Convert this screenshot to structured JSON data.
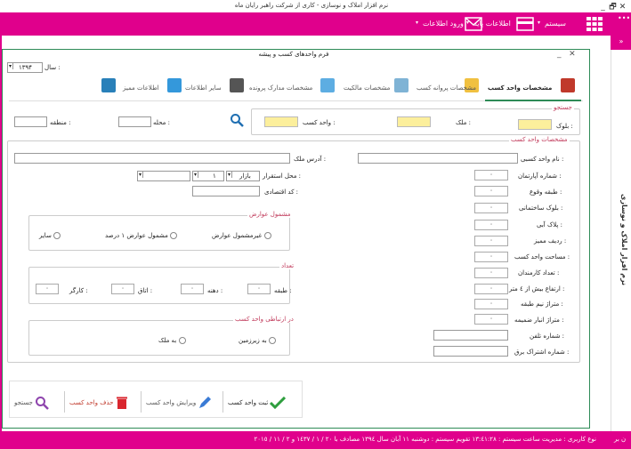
{
  "window": {
    "title": "نرم افزار املاک و نوسازی - کاری از شرکت راهبر رایان ماه",
    "controls": [
      "_",
      "🗗",
      "✕"
    ]
  },
  "menubar": {
    "system": "سیستم",
    "base_info": "اطلاعات پایه",
    "data_entry": "ورود اطلاعات",
    "dots": "•••",
    "collapse": "»"
  },
  "side_panel": {
    "title": "نرم افزار املاک و نوسازی"
  },
  "form": {
    "title": "فرم واحدهای کسب و پیشه",
    "minimize": "_",
    "close": "✕",
    "year_label": "سال :",
    "year_value": "۱۳۹۴",
    "tabs": [
      {
        "label": "مشخصات واحد کسب"
      },
      {
        "label": "مشخصات پروانه کسب"
      },
      {
        "label": "مشخصات مالکیت"
      },
      {
        "label": "مشخصات مدارک پرونده"
      },
      {
        "label": "سایر اطلاعات"
      },
      {
        "label": "اطلاعات ممیز"
      }
    ],
    "search": {
      "legend": "جستجو",
      "block_label": "بلوک :",
      "property_label": "ملک :",
      "unit_label": "واحد کسب :",
      "neighborhood_label": "محله :",
      "region_label": "منطقه :"
    },
    "unit_details": {
      "legend": "مشخصات واحد کسب",
      "left_fields": [
        {
          "label": "نام واحد کسبی :",
          "value": ""
        },
        {
          "label": "شماره آپارتمان :",
          "value": "۰"
        },
        {
          "label": "طبقه وقوع :",
          "value": "۰"
        },
        {
          "label": "بلوک ساختمانی :",
          "value": "۰"
        },
        {
          "label": "پلاک آبی :",
          "value": "۰"
        },
        {
          "label": "ردیف ممیز :",
          "value": "۰"
        },
        {
          "label": "مساحت واحد کسب :",
          "value": "۰"
        },
        {
          "label": "تعداد کارمندان :",
          "value": "۰"
        },
        {
          "label": "ارتفاع بیش از ٤ متر :",
          "value": "۰"
        },
        {
          "label": "متراژ نیم طبقه :",
          "value": "۰"
        },
        {
          "label": "متراژ انبار ضمیمه :",
          "value": "۰"
        },
        {
          "label": "شماره تلفن :",
          "value": ""
        },
        {
          "label": "شماره اشتراک برق :",
          "value": ""
        }
      ],
      "address_label": "آدرس ملک :",
      "location_label": "محل استقرار :",
      "location_value": "بازار",
      "location_number": "۱",
      "economic_code_label": "کد اقتصادی :",
      "duties_group": {
        "legend": "مشمول عوارض",
        "options": [
          "غیرمشمول عوارض",
          "مشمول عوارض ۱ درصد",
          "سایر"
        ]
      },
      "count_group": {
        "legend": "تعداد",
        "fields": [
          {
            "label": "طبقه :",
            "value": "۰"
          },
          {
            "label": "دهنه :",
            "value": "۰"
          },
          {
            "label": "اتاق :",
            "value": "۰"
          },
          {
            "label": "کارگر :",
            "value": "۰"
          }
        ]
      },
      "relation_group": {
        "legend": "در ارتباطی واحد کسب",
        "options": [
          "به زیرزمین",
          "به ملک"
        ]
      }
    },
    "buttons": {
      "register": "ثبت واحد کسب",
      "edit": "ویرایش واحد کسب",
      "delete": "حذف واحد کسب",
      "search": "جستجو"
    }
  },
  "statusbar": {
    "text": "نوع کاربری : مدیریت     ساعت سیستم : ١٣:٤١:٢٨     تقویم سیستم : دوشنبه  ١١  آبان  سال  ١٣٩٤  مصادف با  ٢٠ / ١ / ١٤٣٧  و  ٢ / ١١ / ٢٠١٥",
    "edge": "ن بر"
  },
  "colors": {
    "accent": "#e0008c",
    "frame": "#2e8b57",
    "highlight_input": "#fcef9c",
    "group_label": "#c0395a"
  }
}
